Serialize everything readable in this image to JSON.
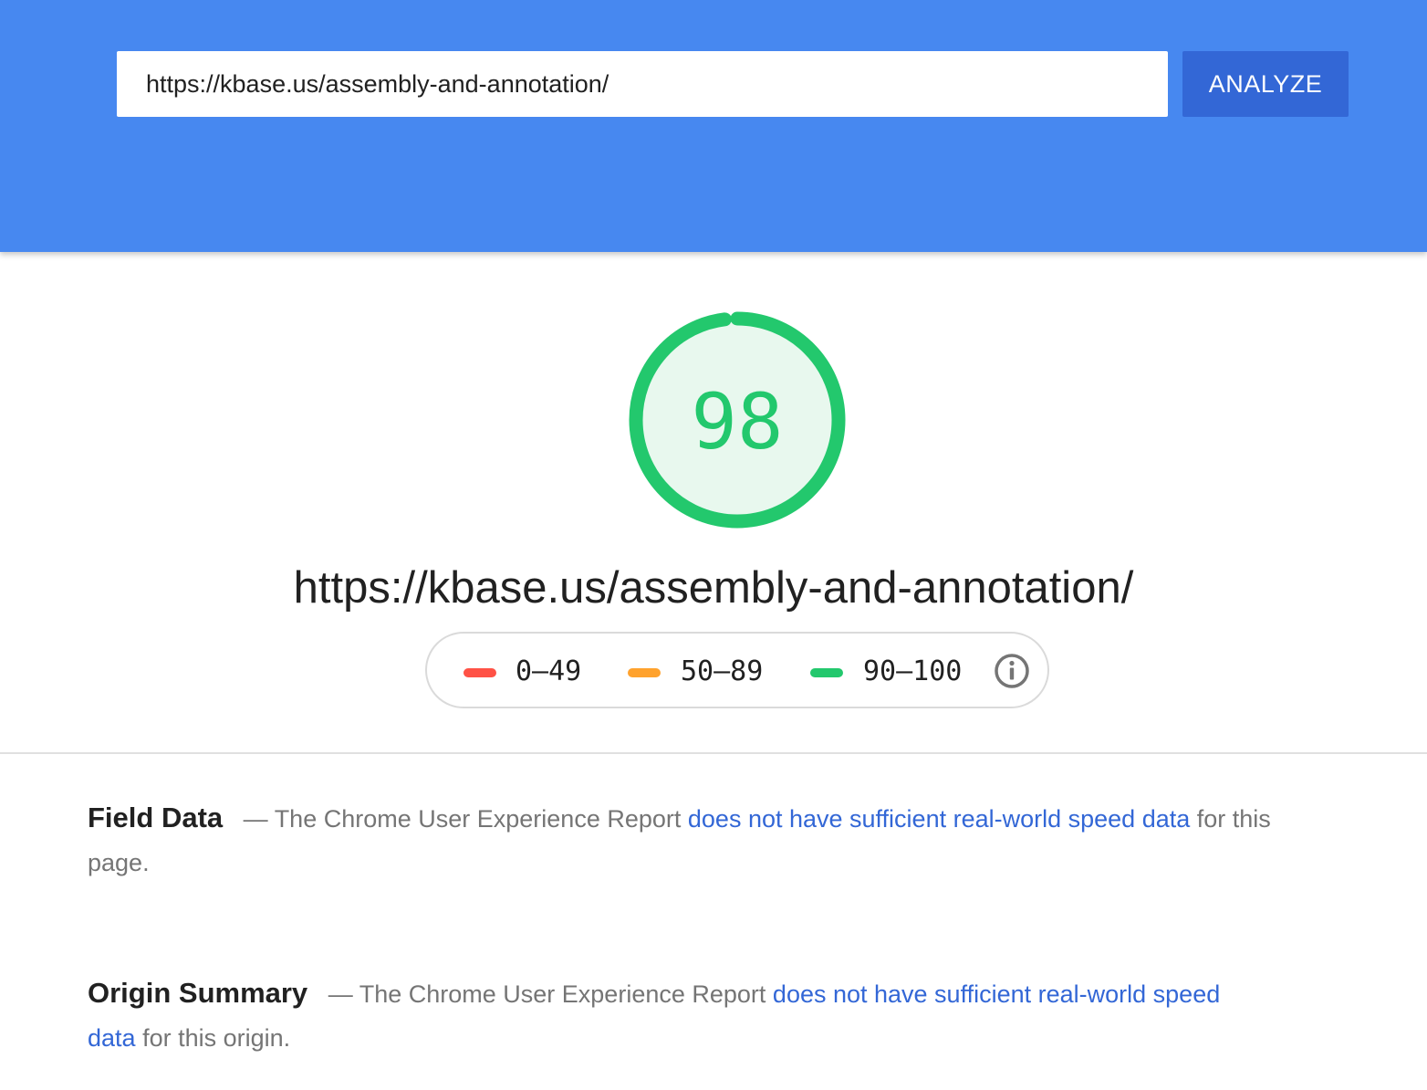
{
  "header": {
    "url_value": "https://kbase.us/assembly-and-annotation/",
    "analyze_label": "ANALYZE",
    "background_color": "#4788f0",
    "button_color": "#3367d6"
  },
  "score": {
    "value": "98",
    "fraction": 0.98,
    "color": "#23c86d",
    "fill_color": "#e8f8ee",
    "tested_url": "https://kbase.us/assembly-and-annotation/"
  },
  "legend": {
    "items": [
      {
        "label": "0–49",
        "color": "#ff5246"
      },
      {
        "label": "50–89",
        "color": "#ffa22d"
      },
      {
        "label": "90–100",
        "color": "#23c86d"
      }
    ],
    "info_icon": "info-icon"
  },
  "field_data": {
    "title": "Field Data",
    "dash": "—",
    "text_before": "The Chrome User Experience Report",
    "link_text": "does not have sufficient real-world speed data",
    "text_after": "for this page."
  },
  "origin_summary": {
    "title": "Origin Summary",
    "dash": "—",
    "text_before": "The Chrome User Experience Report",
    "link_text": "does not have sufficient real-world speed data",
    "text_after": "for this origin."
  }
}
